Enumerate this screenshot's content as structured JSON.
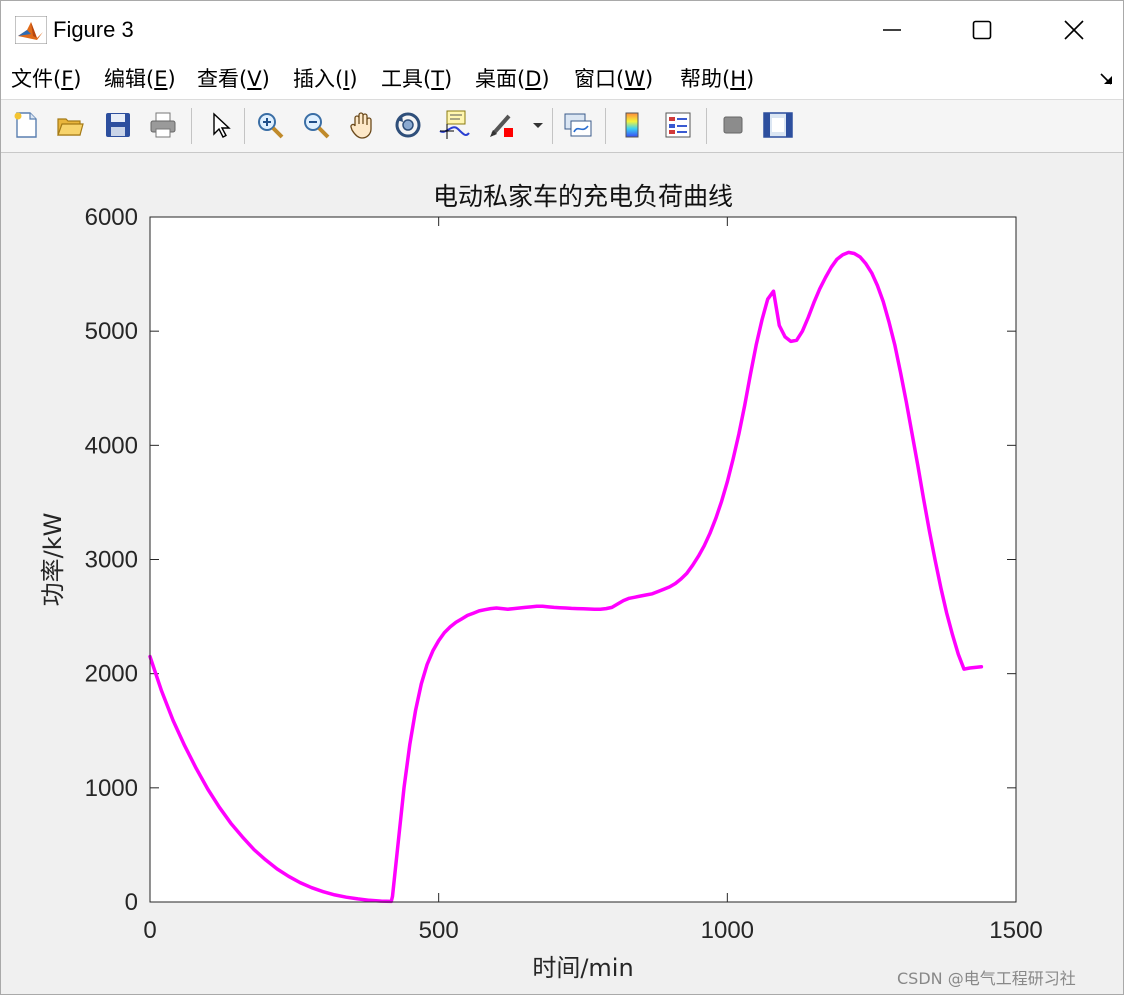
{
  "window": {
    "title": "Figure 3",
    "controls": {
      "minimize": "minimize",
      "maximize": "maximize",
      "close": "close"
    }
  },
  "menubar": {
    "items": [
      {
        "label": "文件(",
        "acc": "F",
        "end": ")"
      },
      {
        "label": "编辑(",
        "acc": "E",
        "end": ")"
      },
      {
        "label": "查看(",
        "acc": "V",
        "end": ")"
      },
      {
        "label": "插入(",
        "acc": "I",
        "end": ")"
      },
      {
        "label": "工具(",
        "acc": "T",
        "end": ")"
      },
      {
        "label": "桌面(",
        "acc": "D",
        "end": ")"
      },
      {
        "label": "窗口(",
        "acc": "W",
        "end": ")"
      },
      {
        "label": "帮助(",
        "acc": "H",
        "end": ")"
      }
    ]
  },
  "toolbar": {
    "icons": [
      "new-file-icon",
      "open-folder-icon",
      "save-icon",
      "print-icon",
      "pointer-icon",
      "zoom-in-icon",
      "zoom-out-icon",
      "pan-hand-icon",
      "rotate-3d-icon",
      "data-cursor-icon",
      "brush-icon",
      "brush-dropdown-icon",
      "link-plot-icon",
      "colorbar-icon",
      "legend-icon",
      "hide-plot-tools-icon",
      "show-plot-tools-icon"
    ]
  },
  "watermark": "CSDN @电气工程研习社",
  "chart_data": {
    "type": "line",
    "title": "电动私家车的充电负荷曲线",
    "xlabel": "时间/min",
    "ylabel": "功率/kW",
    "xlim": [
      0,
      1500
    ],
    "ylim": [
      0,
      6000
    ],
    "xticks": [
      0,
      500,
      1000,
      1500
    ],
    "yticks": [
      0,
      1000,
      2000,
      3000,
      4000,
      5000,
      6000
    ],
    "grid": false,
    "color": "#ff00ff",
    "series": [
      {
        "x": [
          0,
          20,
          40,
          60,
          80,
          100,
          120,
          140,
          160,
          180,
          200,
          220,
          240,
          260,
          280,
          300,
          320,
          340,
          360,
          380,
          400,
          418,
          420,
          430,
          440,
          450,
          460,
          470,
          480,
          490,
          500,
          510,
          520,
          530,
          540,
          550,
          560,
          570,
          580,
          590,
          600,
          610,
          620,
          630,
          640,
          650,
          660,
          670,
          680,
          690,
          700,
          710,
          720,
          730,
          740,
          750,
          760,
          770,
          780,
          790,
          800,
          810,
          820,
          830,
          840,
          850,
          860,
          870,
          880,
          890,
          900,
          910,
          920,
          930,
          940,
          950,
          960,
          970,
          980,
          990,
          1000,
          1010,
          1020,
          1030,
          1040,
          1050,
          1060,
          1070,
          1080,
          1085,
          1090,
          1100,
          1110,
          1120,
          1130,
          1140,
          1150,
          1160,
          1170,
          1180,
          1190,
          1200,
          1210,
          1220,
          1230,
          1240,
          1250,
          1260,
          1270,
          1280,
          1290,
          1300,
          1310,
          1320,
          1330,
          1340,
          1350,
          1360,
          1370,
          1380,
          1390,
          1400,
          1410,
          1420,
          1440
        ],
        "y": [
          2150,
          1850,
          1590,
          1370,
          1170,
          990,
          830,
          690,
          570,
          460,
          370,
          290,
          225,
          170,
          125,
          90,
          62,
          42,
          27,
          15,
          8,
          5,
          50,
          530,
          1000,
          1380,
          1680,
          1910,
          2080,
          2200,
          2290,
          2360,
          2410,
          2450,
          2480,
          2510,
          2530,
          2550,
          2560,
          2570,
          2575,
          2570,
          2565,
          2570,
          2575,
          2580,
          2585,
          2590,
          2590,
          2585,
          2580,
          2578,
          2575,
          2572,
          2570,
          2568,
          2566,
          2565,
          2565,
          2570,
          2580,
          2610,
          2640,
          2660,
          2670,
          2680,
          2690,
          2700,
          2720,
          2740,
          2760,
          2790,
          2830,
          2880,
          2950,
          3030,
          3120,
          3230,
          3360,
          3510,
          3680,
          3880,
          4100,
          4350,
          4620,
          4880,
          5100,
          5280,
          5350,
          5200,
          5050,
          4950,
          4910,
          4920,
          5000,
          5120,
          5250,
          5370,
          5470,
          5560,
          5630,
          5670,
          5690,
          5680,
          5650,
          5590,
          5510,
          5400,
          5260,
          5080,
          4880,
          4640,
          4380,
          4100,
          3820,
          3530,
          3250,
          2990,
          2750,
          2530,
          2340,
          2170,
          2040,
          2050,
          2060
        ]
      }
    ]
  }
}
